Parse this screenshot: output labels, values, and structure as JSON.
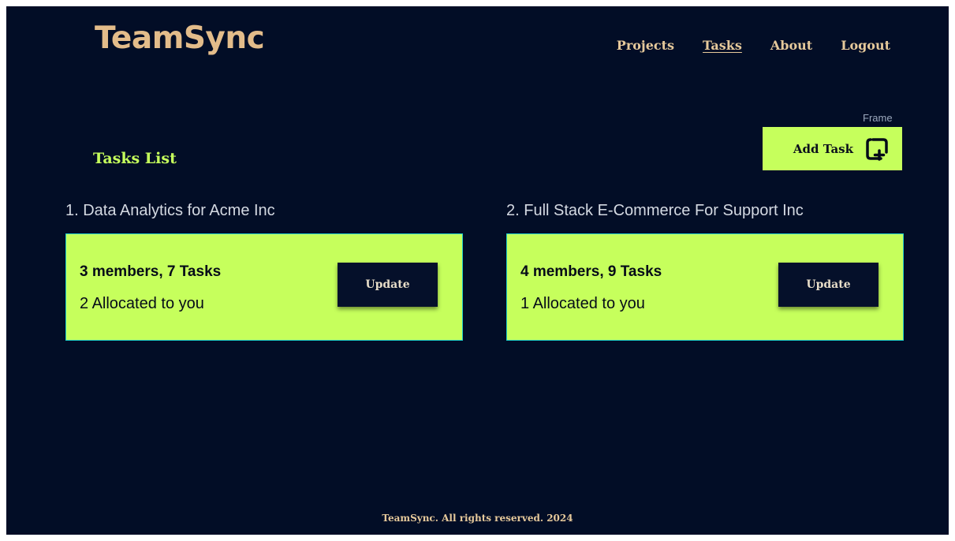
{
  "app": {
    "logo": "TeamSync"
  },
  "nav": {
    "items": [
      {
        "label": "Projects",
        "active": false
      },
      {
        "label": "Tasks",
        "active": true
      },
      {
        "label": "About",
        "active": false
      },
      {
        "label": "Logout",
        "active": false
      }
    ]
  },
  "toolbar": {
    "frame_label": "Frame",
    "add_task_label": "Add Task",
    "add_task_icon": "add-square-icon"
  },
  "page": {
    "title": "Tasks List"
  },
  "projects": [
    {
      "heading": "1. Data Analytics for Acme Inc",
      "stats": "3 members, 7 Tasks",
      "allocated": "2 Allocated to you",
      "button_label": "Update"
    },
    {
      "heading": "2. Full Stack E-Commerce For Support Inc",
      "stats": "4 members, 9 Tasks",
      "allocated": "1 Allocated to you",
      "button_label": "Update"
    }
  ],
  "footer": {
    "text": "TeamSync. All rights reserved. 2024"
  },
  "colors": {
    "background": "#020d26",
    "accent": "#c6ff5c",
    "card_border": "#1fcfc8",
    "logo": "#e3bc8a",
    "nav_text": "#e6c99b",
    "button_dark": "#05102a"
  }
}
